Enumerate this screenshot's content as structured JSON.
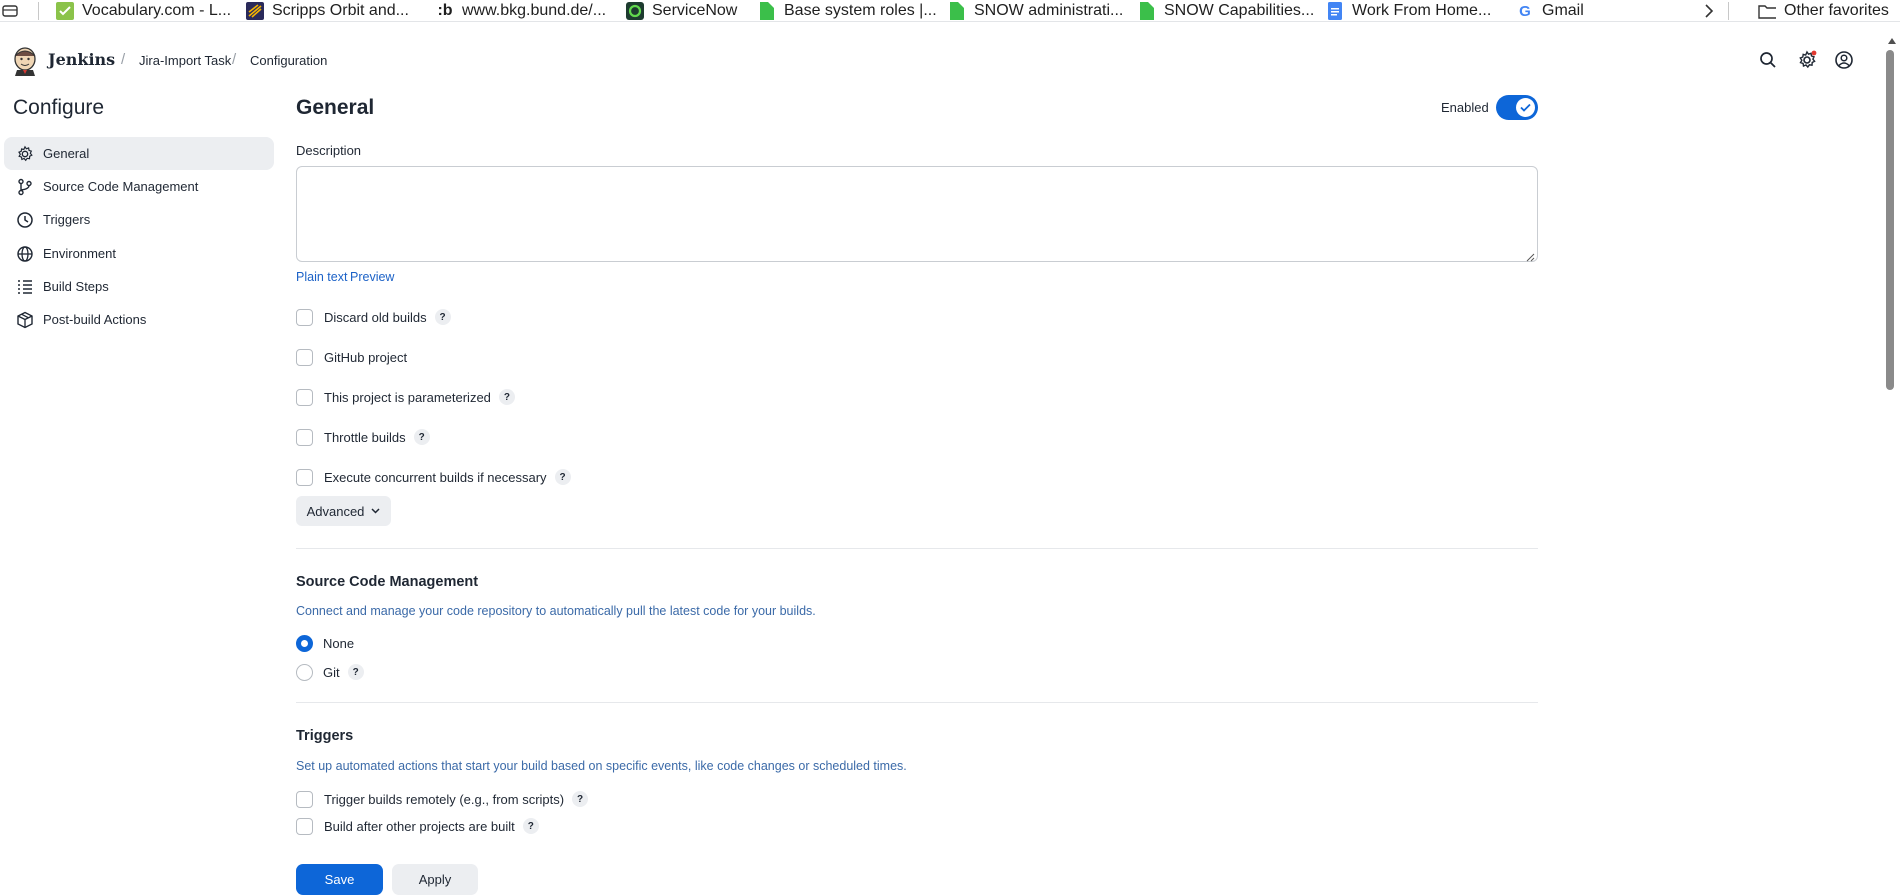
{
  "bookmarks": {
    "items": [
      {
        "label": "Vocabulary.com - L...",
        "icon": "vocabulary-checkmark-icon"
      },
      {
        "label": "Scripps Orbit and...",
        "icon": "scripps-orbit-icon"
      },
      {
        "label": "www.bkg.bund.de/...",
        "icon": "bkg-b-icon"
      },
      {
        "label": "ServiceNow",
        "icon": "servicenow-icon"
      },
      {
        "label": "Base system roles |...",
        "icon": "green-doc-icon"
      },
      {
        "label": "SNOW administrati...",
        "icon": "green-doc-icon"
      },
      {
        "label": "SNOW Capabilities...",
        "icon": "green-doc-icon"
      },
      {
        "label": "Work From Home...",
        "icon": "google-docs-icon"
      },
      {
        "label": "Gmail",
        "icon": "google-g-icon"
      }
    ],
    "other_favorites": "Other favorites"
  },
  "header": {
    "brand": "Jenkins",
    "breadcrumbs": [
      "Jira-Import Task",
      "Configuration"
    ]
  },
  "sidebar": {
    "title": "Configure",
    "items": [
      {
        "label": "General",
        "icon": "gear-icon",
        "active": true
      },
      {
        "label": "Source Code Management",
        "icon": "git-branch-icon",
        "active": false
      },
      {
        "label": "Triggers",
        "icon": "clock-icon",
        "active": false
      },
      {
        "label": "Environment",
        "icon": "globe-icon",
        "active": false
      },
      {
        "label": "Build Steps",
        "icon": "list-icon",
        "active": false
      },
      {
        "label": "Post-build Actions",
        "icon": "package-icon",
        "active": false
      }
    ]
  },
  "general": {
    "title": "General",
    "enabled_label": "Enabled",
    "enabled": true,
    "description_label": "Description",
    "description_value": "",
    "plain_text": "Plain text",
    "preview": "Preview",
    "options": [
      {
        "label": "Discard old builds",
        "help": "?",
        "checked": false
      },
      {
        "label": "GitHub project",
        "help": "",
        "checked": false
      },
      {
        "label": "This project is parameterized",
        "help": "?",
        "checked": false
      },
      {
        "label": "Throttle builds",
        "help": "?",
        "checked": false
      },
      {
        "label": "Execute concurrent builds if necessary",
        "help": "?",
        "checked": false
      }
    ],
    "advanced_label": "Advanced"
  },
  "scm": {
    "title": "Source Code Management",
    "description": "Connect and manage your code repository to automatically pull the latest code for your builds.",
    "options": [
      {
        "label": "None",
        "checked": true
      },
      {
        "label": "Git",
        "checked": false
      }
    ],
    "git_help": "?"
  },
  "triggers": {
    "title": "Triggers",
    "description": "Set up automated actions that start your build based on specific events, like code changes or scheduled times.",
    "options": [
      {
        "label": "Trigger builds remotely (e.g., from scripts)",
        "help": "?"
      },
      {
        "label": "Build after other projects are built",
        "help": "?"
      }
    ]
  },
  "actions": {
    "save_label": "Save",
    "apply_label": "Apply"
  },
  "colors": {
    "accent": "#0d66d8",
    "link": "#1c62c7",
    "section_desc": "#3b6aa8"
  }
}
